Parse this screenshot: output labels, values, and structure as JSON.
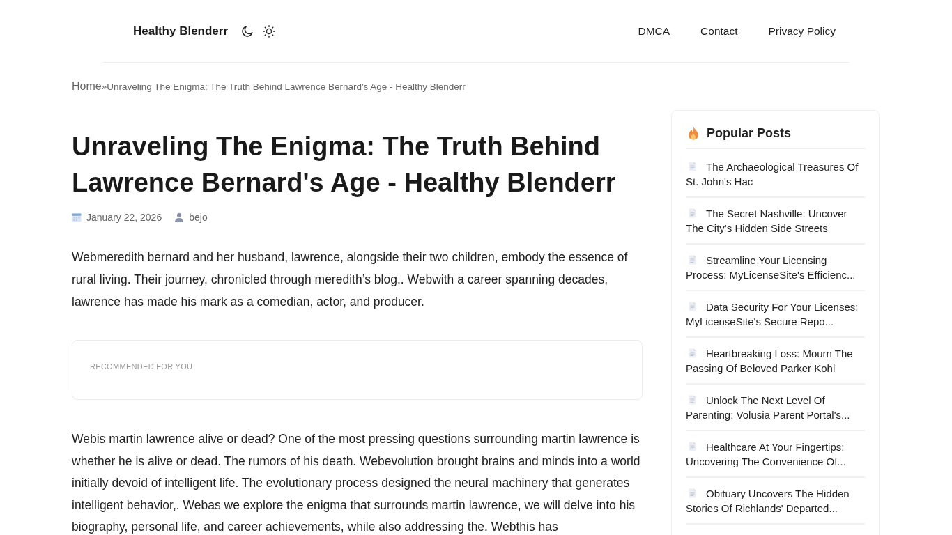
{
  "header": {
    "brand": "Healthy Blenderr",
    "nav": [
      "DMCA",
      "Contact",
      "Privacy Policy"
    ]
  },
  "breadcrumb": {
    "home": "Home",
    "separator": "»",
    "current": "Unraveling The Enigma: The Truth Behind Lawrence Bernard's Age - Healthy Blenderr"
  },
  "article": {
    "title": "Unraveling The Enigma: The Truth Behind Lawrence Bernard's Age - Healthy Blenderr",
    "date": "January 22, 2026",
    "author": "bejo",
    "intro": "Webmeredith bernard and her husband, lawrence, alongside their two children, embody the essence of rural living. Their journey, chronicled through meredith’s blog,. Webwith a career spanning decades, lawrence has made his mark as a comedian, actor, and producer.",
    "recommended": {
      "label": "RECOMMENDED FOR YOU"
    },
    "body": "Webis martin lawrence alive or dead? One of the most pressing questions surrounding martin lawrence is whether he is alive or dead. The rumors of his death. Webevolution brought brains and minds into a world initially devoid of intelligent life. The evolutionary process designed the neural machinery that generates intelligent behavior,. Webas we explore the enigma that surrounds martin lawrence, we will delve into his biography, personal life, and career achievements, while also addressing the. Webthis has"
  },
  "sidebar": {
    "title": "Popular Posts",
    "posts": [
      "The Archaeological Treasures Of St. John's Hac",
      "The Secret Nashville: Uncover The City's Hidden Side Streets",
      "Streamline Your Licensing Process: MyLicenseSite's Efficienc...",
      "Data Security For Your Licenses: MyLicenseSite's Secure Repo...",
      "Heartbreaking Loss: Mourn The Passing Of Beloved Parker Kohl",
      "Unlock The Next Level Of Parenting: Volusia Parent Portal's...",
      "Healthcare At Your Fingertips: Uncovering The Convenience Of...",
      "Obituary Uncovers The Hidden Stories Of Richlands' Departed..."
    ]
  }
}
